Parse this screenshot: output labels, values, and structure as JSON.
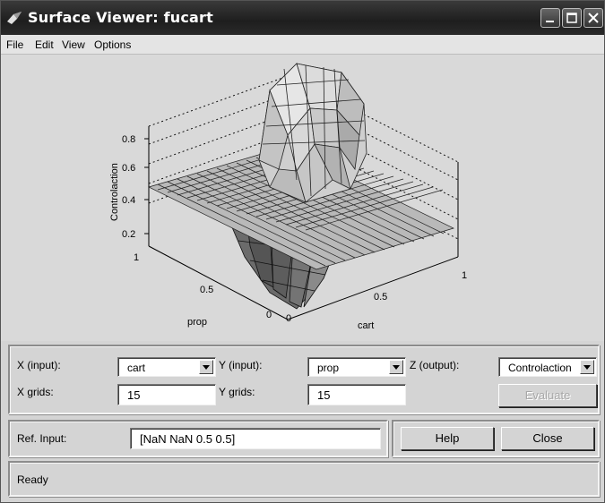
{
  "window": {
    "title": "Surface Viewer: fucart"
  },
  "menu": [
    "File",
    "Edit",
    "View",
    "Options"
  ],
  "plot": {
    "zlabel": "Controlaction",
    "ylabel": "prop",
    "xlabel": "cart",
    "z_ticks": [
      "0.8",
      "0.6",
      "0.4",
      "0.2"
    ],
    "y_ticks": [
      "1",
      "0.5",
      "0"
    ],
    "x_ticks": [
      "0",
      "0.5",
      "1"
    ]
  },
  "controls": {
    "x_input_label": "X (input):",
    "x_input_value": "cart",
    "y_input_label": "Y (input):",
    "y_input_value": "prop",
    "z_output_label": "Z (output):",
    "z_output_value": "Controlaction",
    "x_grids_label": "X grids:",
    "x_grids_value": "15",
    "y_grids_label": "Y grids:",
    "y_grids_value": "15",
    "evaluate_label": "Evaluate"
  },
  "ref_input": {
    "label": "Ref. Input:",
    "value": "[NaN NaN 0.5 0.5]"
  },
  "buttons": {
    "help": "Help",
    "close": "Close"
  },
  "status": {
    "text": "Ready"
  }
}
